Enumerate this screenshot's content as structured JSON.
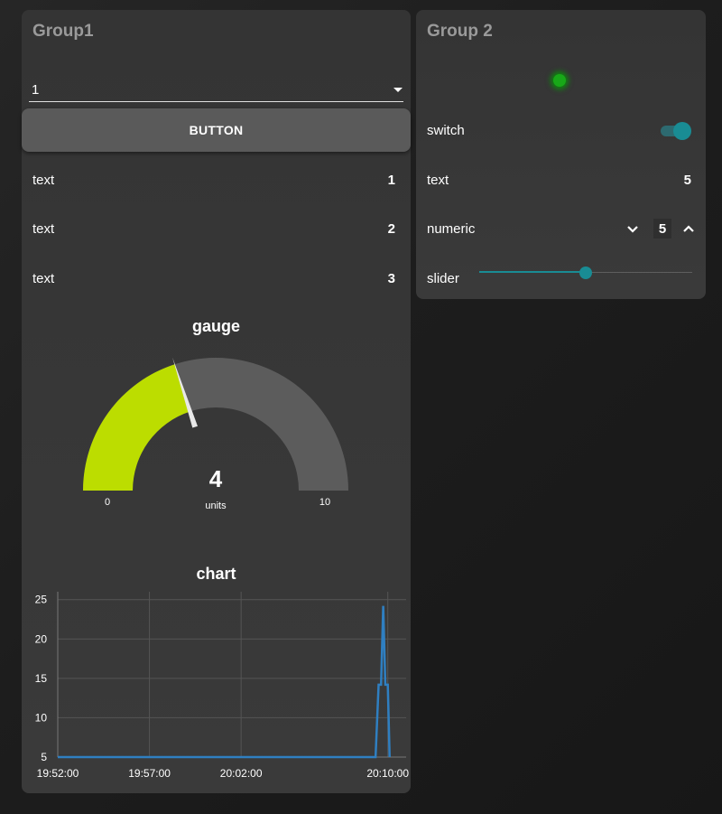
{
  "colors": {
    "accent": "#198c94",
    "gauge_fill": "#bcdd00",
    "gauge_track": "#5c5c5c",
    "led_on": "#18a818",
    "chart_line": "#2f7fc1"
  },
  "group1": {
    "title": "Group1",
    "dropdown": {
      "value": "1"
    },
    "button": {
      "label": "BUTTON"
    },
    "texts": [
      {
        "label": "text",
        "value": "1"
      },
      {
        "label": "text",
        "value": "2"
      },
      {
        "label": "text",
        "value": "3"
      }
    ],
    "gauge": {
      "title": "gauge",
      "value": 4,
      "min": 0,
      "max": 10,
      "units": "units",
      "min_label": "0",
      "max_label": "10",
      "value_label": "4"
    },
    "chart": {
      "title": "chart"
    }
  },
  "group2": {
    "title": "Group 2",
    "led": {
      "state": "on",
      "icon": "status-led-icon"
    },
    "switch": {
      "label": "switch",
      "state": "on"
    },
    "text": {
      "label": "text",
      "value": "5"
    },
    "numeric": {
      "label": "numeric",
      "value": "5",
      "down_icon": "chevron-down-icon",
      "up_icon": "chevron-up-icon"
    },
    "slider": {
      "label": "slider",
      "value": 0.5
    }
  },
  "chart_data": {
    "type": "line",
    "title": "chart",
    "xlabel": "",
    "ylabel": "",
    "x_range": [
      "19:52:00",
      "20:11:00"
    ],
    "ylim": [
      5,
      26
    ],
    "x_ticks": [
      "19:52:00",
      "19:57:00",
      "20:02:00",
      "20:10:00"
    ],
    "y_ticks": [
      "5",
      "10",
      "15",
      "20",
      "25"
    ],
    "grid": true,
    "series": [
      {
        "x": [
          "19:52:00",
          "20:09:20",
          "20:09:30",
          "20:09:38",
          "20:09:45",
          "20:09:52",
          "20:10:00",
          "20:10:06"
        ],
        "y": [
          5,
          5,
          14.2,
          14.2,
          24.2,
          14.2,
          14.2,
          5
        ]
      }
    ]
  }
}
